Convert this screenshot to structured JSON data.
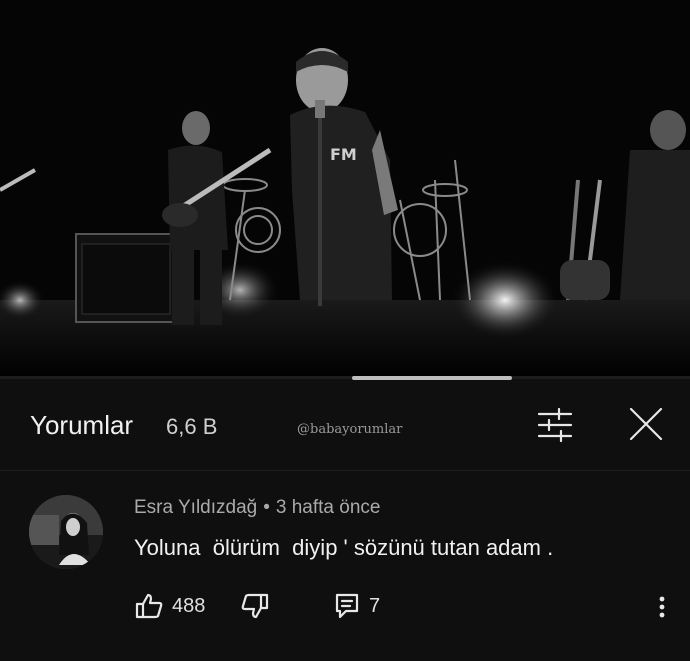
{
  "video": {
    "stage_icon": "concert-stage-scene-image",
    "shirt_text": "FM"
  },
  "comments_panel": {
    "title": "Yorumlar",
    "count": "6,6 B",
    "watermark": "@babayorumlar",
    "sort_icon": "sliders-icon",
    "close_icon": "close-icon"
  },
  "comment": {
    "author": "Esra Yıldızdağ",
    "separator": "•",
    "time": "3 hafta önce",
    "text": "Yoluna  ölürüm  diyip ' sözünü tutan adam .",
    "likes": "488",
    "replies": "7",
    "like_icon": "thumbs-up-icon",
    "dislike_icon": "thumbs-down-icon",
    "reply_icon": "reply-icon",
    "more_icon": "more-vert-icon"
  },
  "colors": {
    "background": "#0f0f0f",
    "text_primary": "#f1f1f1",
    "text_secondary": "#aaaaaa"
  }
}
